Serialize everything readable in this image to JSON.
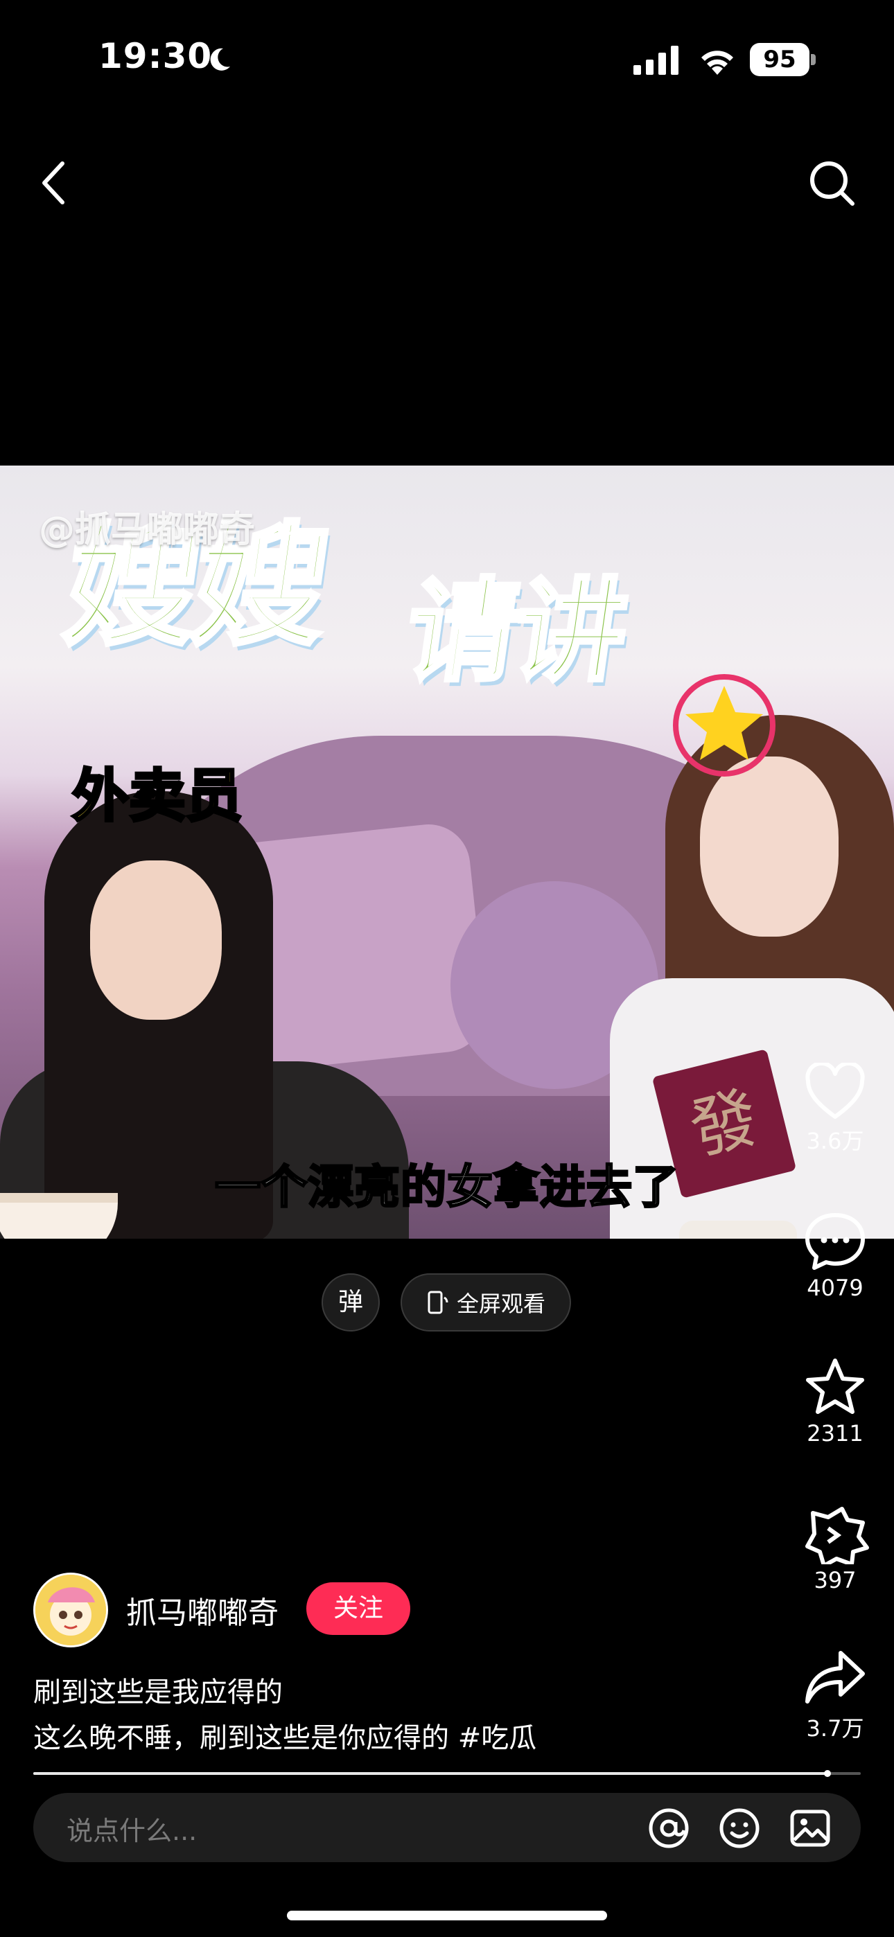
{
  "status_bar": {
    "time": "19:30",
    "battery": "95"
  },
  "video": {
    "watermark": "@抓马嘟嘟奇",
    "title_line1": "嫂嫂",
    "title_line2": "请讲",
    "label": "外卖员",
    "subtitle": "一个漂亮的女拿进去了",
    "prop_text": "發"
  },
  "controls": {
    "danmu_label": "弹",
    "fullscreen_label": "全屏观看"
  },
  "actions": {
    "likes": "3.6万",
    "comments": "4079",
    "favorites": "2311",
    "tags": "397",
    "shares": "3.7万"
  },
  "author": {
    "name": "抓马嘟嘟奇",
    "follow_label": "关注"
  },
  "caption": {
    "line1": "刷到这些是我应得的",
    "line2_text": "这么晚不睡，刷到这些是你应得的 ",
    "hashtag": "#吃瓜"
  },
  "progress": {
    "fraction": 0.96
  },
  "comment": {
    "placeholder": "说点什么..."
  },
  "colors": {
    "follow": "#fe2c55",
    "background": "#000000"
  }
}
